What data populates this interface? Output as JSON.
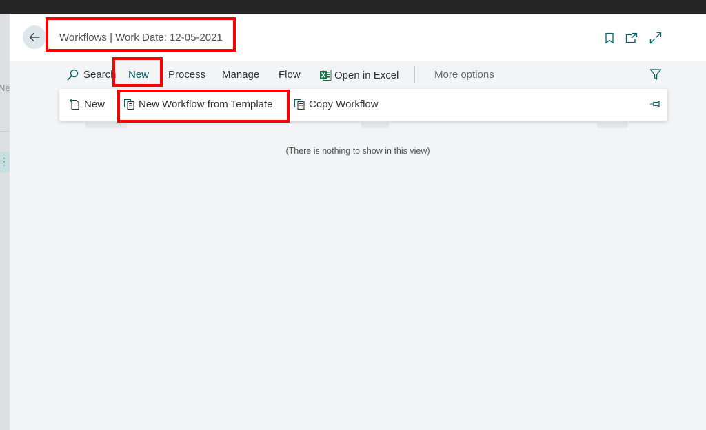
{
  "header": {
    "title": "Workflows | Work Date: 12-05-2021",
    "icons": [
      "back-arrow-icon",
      "bookmark-icon",
      "open-new-window-icon",
      "expand-icon"
    ]
  },
  "left_panel": {
    "cut_label": "Ne"
  },
  "actions": {
    "search": "Search",
    "new": "New",
    "process": "Process",
    "manage": "Manage",
    "flow": "Flow",
    "open_in_excel": "Open in Excel",
    "more_options": "More options"
  },
  "new_menu": {
    "new": "New",
    "new_from_template": "New Workflow from Template",
    "copy_workflow": "Copy Workflow"
  },
  "empty_message": "(There is nothing to show in this view)",
  "colors": {
    "accent": "#00626a",
    "highlight": "#ff0000",
    "excel": "#1e7145"
  }
}
